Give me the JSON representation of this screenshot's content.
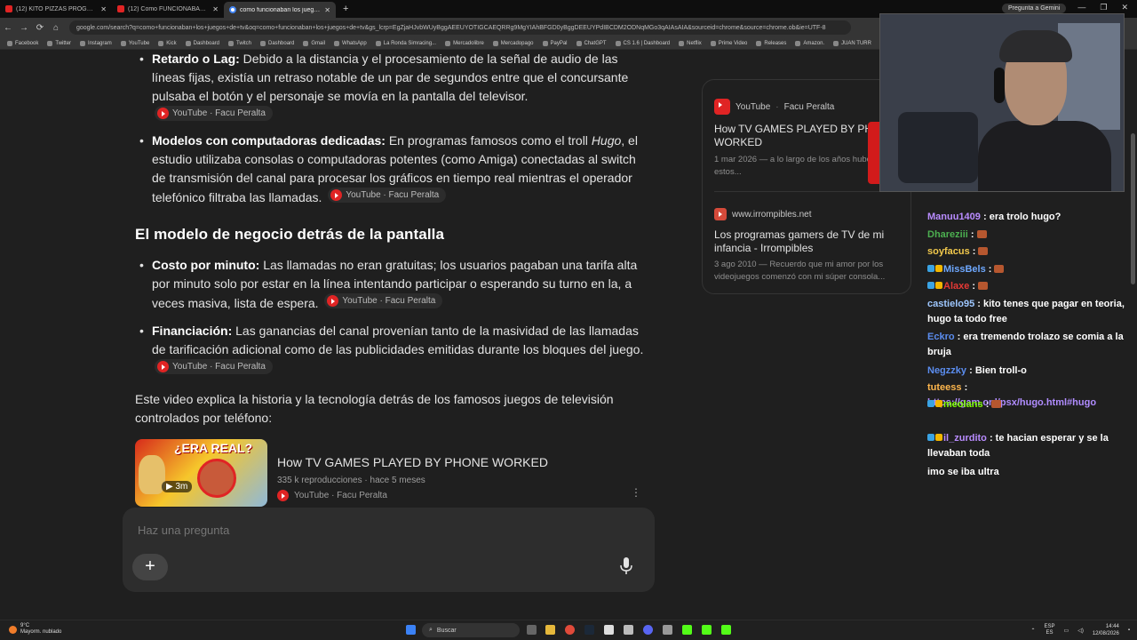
{
  "browser": {
    "tabs": [
      {
        "title": "(12) KITO PIZZAS PROGRAMA #",
        "icon": "youtube-icon",
        "active": false
      },
      {
        "title": "(12) Como FUNCIONABAN los",
        "icon": "youtube-icon",
        "active": false
      },
      {
        "title": "como funcionaban los juegos d",
        "icon": "google-icon",
        "active": true
      }
    ],
    "new_tab_label": "+",
    "gemini_button": "Pregunta a Gemini",
    "url": "google.com/search?q=como+funcionaban+los+juegos+de+tv&oq=como+funcionaban+los+juegos+de+tv&gs_lcrp=EgZjaHJvbWUyBggAEEUYOTIGCAEQRRg9MgYIAhBFGD0yBggDEEUYPdIBCDM2ODNqMGo3qAIAsAIA&sourceid=chrome&source=chrome.ob&ie=UTF-8",
    "bookmarks": [
      "Facebook",
      "Twitter",
      "Instagram",
      "YouTube",
      "Kick",
      "Dashboard",
      "Twitch",
      "Dashboard",
      "Gmail",
      "WhatsApp",
      "La Ronda Simracing...",
      "Mercadolibre",
      "Mercadopago",
      "PayPal",
      "ChatGPT",
      "CS 1.6 | Dashboard",
      "Netflix",
      "Prime Video",
      "Releases",
      "Amazon.",
      "JUAN TURR"
    ]
  },
  "ai_overview": {
    "item_lag": {
      "bold": "Retardo o Lag:",
      "text": " Debido a la distancia y el procesamiento de la señal de audio de las líneas fijas, existía un retraso notable de un par de segundos entre que el concursante pulsaba el botón y el personaje se movía en la pantalla del televisor."
    },
    "item_computers": {
      "bold": "Modelos con computadoras dedicadas:",
      "text_before": " En programas famosos como el troll ",
      "italic": "Hugo",
      "text_after": ", el estudio utilizaba consolas o computadoras potentes (como Amiga) conectadas al switch de transmisión del canal para procesar los gráficos en tiempo real mientras el operador telefónico filtraba las llamadas."
    },
    "heading": "El modelo de negocio detrás de la pantalla",
    "item_cost": {
      "bold": "Costo por minuto:",
      "text": " Las llamadas no eran gratuitas; los usuarios pagaban una tarifa alta por minuto solo por estar en la línea intentando participar o esperando su turno en la, a veces masiva, lista de espera."
    },
    "item_finance": {
      "bold": "Financiación:",
      "text": " Las ganancias del canal provenían tanto de la masividad de las llamadas de tarificación adicional como de las publicidades emitidas durante los bloques del juego."
    },
    "source_chip": "YouTube · Facu Peralta",
    "intro_video": "Este video explica la historia y la tecnología detrás de los famosos juegos de televisión controlados por teléfono:",
    "video": {
      "thumb_text": "¿ERA REAL?",
      "duration": "3m",
      "title": "How TV GAMES PLAYED BY PHONE WORKED",
      "meta": "335 k reproducciones · hace 5 meses",
      "source": "YouTube · Facu Peralta"
    },
    "ask_placeholder": "Haz una pregunta",
    "plus_label": "+"
  },
  "sources": [
    {
      "site": "YouTube",
      "author": "Facu Peralta",
      "title": "How TV GAMES PLAYED BY PHONE WORKED",
      "snippet": "1 mar 2026 — a lo largo de los años hubo varios de estos..."
    },
    {
      "site": "www.irrompibles.net",
      "title": "Los programas gamers de TV de mi infancia - Irrompibles",
      "snippet": "3 ago 2010 — Recuerdo que mi amor por los videojuegos comenzó con mi súper consola..."
    }
  ],
  "chat": [
    {
      "user": "Manuu1409",
      "color": "#b98cff",
      "text": "era trolo hugo?"
    },
    {
      "user": "Dhareziii",
      "color": "#4caf50",
      "text": ""
    },
    {
      "user": "soyfacus",
      "color": "#f2c94c",
      "text": ""
    },
    {
      "user": "MissBels",
      "color": "#6ea8ff",
      "text": ""
    },
    {
      "user": "Alaxe",
      "color": "#e53935",
      "text": ""
    },
    {
      "user": "castielo95",
      "color": "#9ec7ff",
      "text": "kito tenes que pagar en teoria, hugo ta todo free"
    },
    {
      "user": "Eckro",
      "color": "#5b8def",
      "text": "era tremendo trolazo se comia a la bruja"
    },
    {
      "user": "Negzzky",
      "color": "#5b8def",
      "text": "Bien troll-o"
    },
    {
      "user": "tuteess",
      "color": "#ffb74d",
      "text": "",
      "link": "https://gam.onl/psx/hugo.html#hugo"
    },
    {
      "user": "meolans",
      "color": "#7cfc00",
      "text": ""
    },
    {
      "user": "il_zurdito",
      "color": "#b98cff",
      "text": "te hacian esperar y se la llevaban toda"
    },
    {
      "user": "",
      "color": "#ffffff",
      "text": "imo se iba ultra"
    }
  ],
  "taskbar": {
    "weather_temp": "9°C",
    "weather_desc": "Mayorm. nublado",
    "search_label": "Buscar",
    "lang": "ESP",
    "lang_sub": "ES",
    "time": "14:44",
    "date": "12/08/2026"
  },
  "colors": {
    "background": "#1f1f1f",
    "youtube_red": "#e02424",
    "chip_bg": "#2c2c2c"
  }
}
